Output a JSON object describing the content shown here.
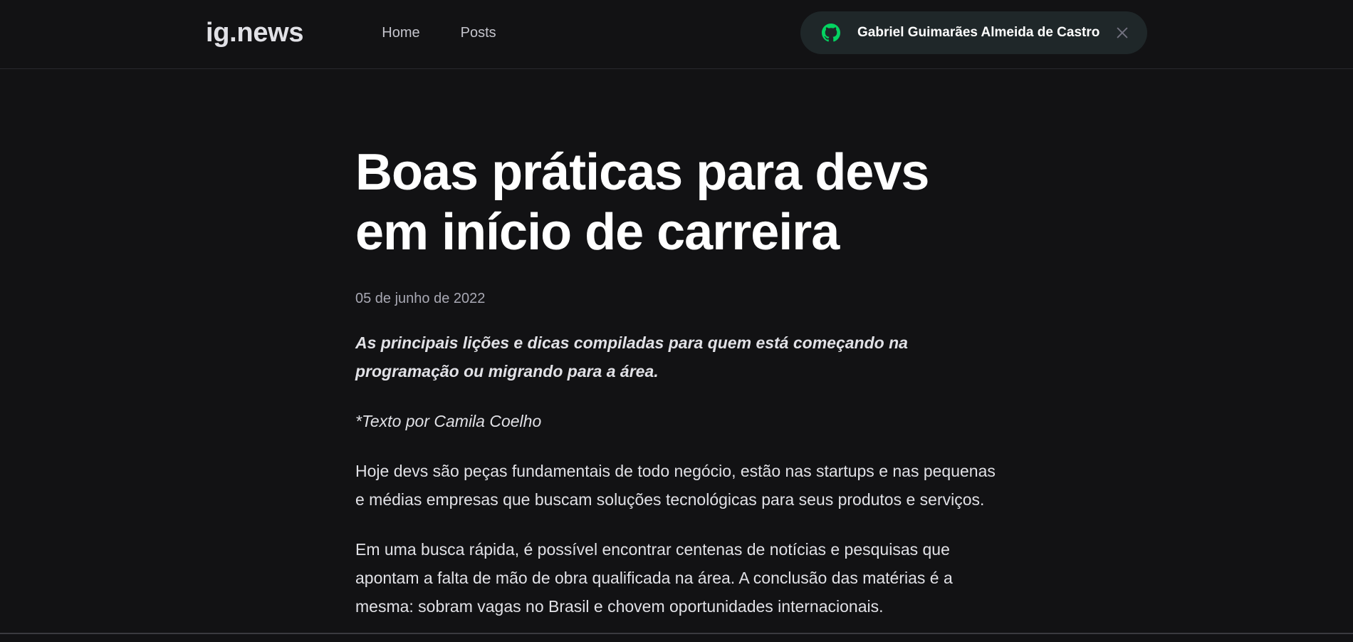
{
  "header": {
    "logo": "ig.news",
    "nav": [
      {
        "label": "Home"
      },
      {
        "label": "Posts"
      }
    ],
    "user_button": {
      "icon": "github-icon",
      "name": "Gabriel Guimarães Almeida de Castro",
      "close_icon": "close-icon",
      "icon_color": "#04d361"
    }
  },
  "post": {
    "title": "Boas práticas para devs em início de carreira",
    "date": "05 de junho de 2022",
    "lead": "As principais lições e dicas compiladas para quem está começando na programação ou migrando para a área.",
    "byline": "*Texto por Camila Coelho",
    "paragraphs": [
      "Hoje devs são peças fundamentais de todo negócio, estão nas startups e nas pequenas e médias empresas que buscam soluções tecnológicas para seus produtos e serviços.",
      "Em uma busca rápida, é possível encontrar centenas de notícias e pesquisas que apontam a falta de mão de obra qualificada na área. A conclusão das matérias é a mesma: sobram vagas no Brasil e chovem oportunidades internacionais."
    ]
  },
  "colors": {
    "background": "#121214",
    "accent": "#04d361",
    "header_pill": "#1f2729"
  }
}
